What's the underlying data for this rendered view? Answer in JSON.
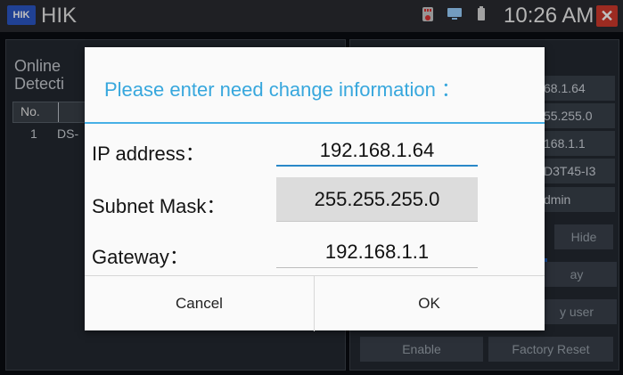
{
  "statusbar": {
    "logo_text": "HIK",
    "app_name": "HIK",
    "time": "10:26 AM",
    "icons": [
      "sd-card-icon",
      "monitor-icon",
      "battery-icon",
      "close-x-icon"
    ]
  },
  "background": {
    "online_title": "Online\nDetecti",
    "table": {
      "header_no": "No.",
      "row_no": "1",
      "row_dev": "DS-"
    },
    "right_fields": [
      "68.1.64",
      "55.255.0",
      "168.1.1",
      "D3T45-I3",
      "dmin"
    ],
    "buttons": {
      "hide": "Hide",
      "ay": "ay",
      "y_user": "y user",
      "enable": "Enable",
      "factory_reset": "Factory Reset"
    }
  },
  "dialog": {
    "title": "Please enter need change information ：",
    "labels": {
      "ip": "IP address：",
      "mask": "Subnet Mask：",
      "gateway": "Gateway："
    },
    "values": {
      "ip": "192.168.1.64",
      "mask": "255.255.255.0",
      "gateway": "192.168.1.1"
    },
    "buttons": {
      "cancel": "Cancel",
      "ok": "OK"
    },
    "colors": {
      "title": "#37a7dd",
      "accent": "#47b0e6"
    }
  }
}
